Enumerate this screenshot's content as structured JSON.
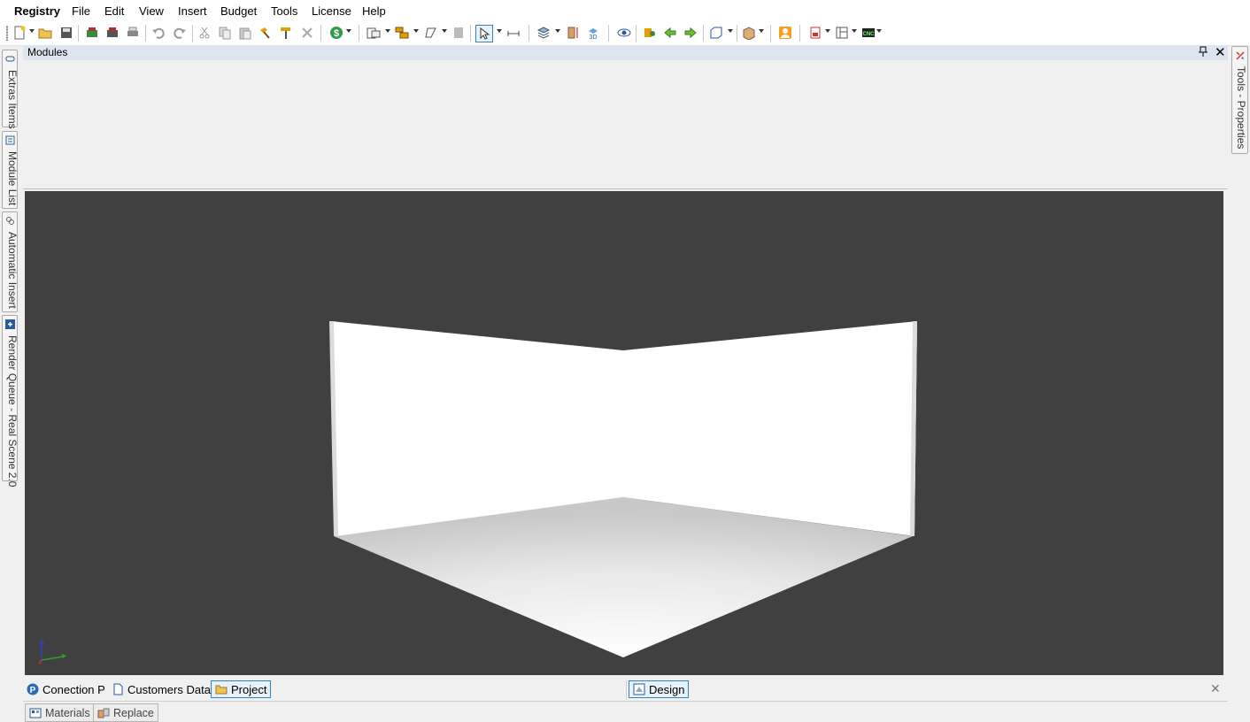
{
  "menu": {
    "items": [
      "Registry",
      "File",
      "Edit",
      "View",
      "Insert",
      "Budget",
      "Tools",
      "License",
      "Help"
    ]
  },
  "toolbar": {
    "icons": [
      "new-file-icon",
      "open-folder-icon",
      "save-icon",
      "budget-green-icon",
      "budget-dark-icon",
      "print-icon",
      "undo-icon",
      "redo-icon",
      "cut-icon",
      "copy-icon",
      "paste-icon",
      "hammer-icon",
      "paint-roller-icon",
      "delete-icon",
      "dollar-icon",
      "module-tools-icon",
      "group-icon",
      "shape-icon",
      "panel-icon",
      "select-arrow-icon",
      "measure-icon",
      "layers-icon",
      "door-height-icon",
      "view-3d-icon",
      "eye-icon",
      "render-icon",
      "arrow-left-icon",
      "arrow-right-icon",
      "box-view-icon",
      "cabinet-icon",
      "user-icon",
      "report-icon",
      "layout-icon",
      "cnc-icon"
    ]
  },
  "left_tabs": [
    {
      "label": "Extras Items",
      "icon": "extras-icon"
    },
    {
      "label": "Module List",
      "icon": "list-icon"
    },
    {
      "label": "Automatic Insert",
      "icon": "link-icon"
    },
    {
      "label": "Render Queue - Real Scene 2.0",
      "icon": "render-queue-icon"
    }
  ],
  "right_tabs": [
    {
      "label": "Tools - Properties",
      "icon": "tools-icon"
    }
  ],
  "modules_panel": {
    "title": "Modules",
    "pin_glyph": "📌",
    "close_glyph": "✕"
  },
  "document_tabs": {
    "left": [
      {
        "label": "Conection P",
        "icon": "connection-icon",
        "active": false
      },
      {
        "label": "Customers Data",
        "icon": "document-icon",
        "active": false
      },
      {
        "label": "Project",
        "icon": "folder-icon",
        "active": true
      }
    ],
    "right": [
      {
        "label": "Design",
        "icon": "design-icon",
        "active": true
      }
    ],
    "close_glyph": "✕"
  },
  "panel_tabs": [
    {
      "label": "Materials",
      "icon": "materials-icon"
    },
    {
      "label": "Replace",
      "icon": "replace-icon"
    }
  ],
  "colors": {
    "viewport_bg": "#404040",
    "active_tab_border": "#3c7fb1",
    "header_bg": "#dde6f0"
  }
}
